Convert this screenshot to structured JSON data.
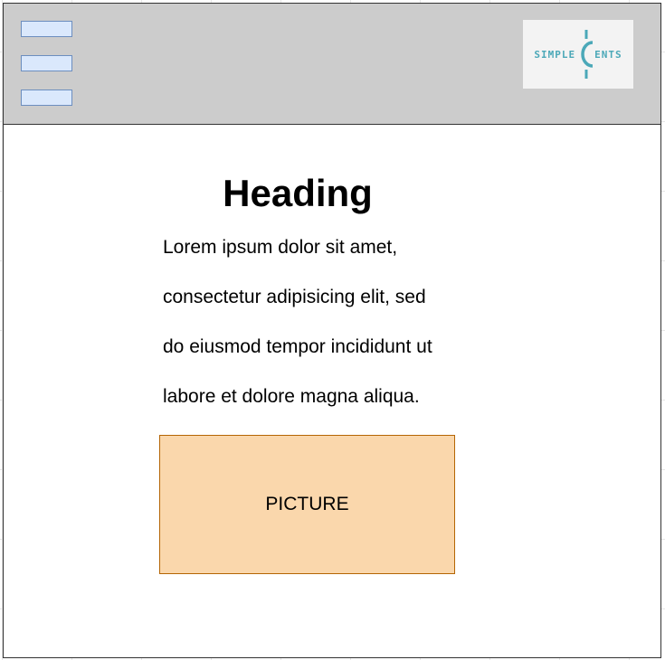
{
  "header": {
    "menu_items": 3,
    "background": "#cccccc",
    "logo": {
      "text_left": "SIMPLE",
      "text_right": "ENTS",
      "accent_color": "#4ba8b8",
      "icon": "cent-sign-icon"
    }
  },
  "main": {
    "heading": "Heading",
    "paragraph_lines": [
      "Lorem ipsum dolor sit amet,",
      "consectetur adipisicing elit, sed",
      "do eiusmod tempor incididunt ut",
      "labore et dolore magna aliqua."
    ],
    "picture_label": "PICTURE",
    "picture_fill": "#fad7ac",
    "picture_border": "#b46504"
  },
  "colors": {
    "menu_bar_fill": "#dae8fc",
    "menu_bar_border": "#6c8ebf",
    "frame_border": "#333333"
  }
}
